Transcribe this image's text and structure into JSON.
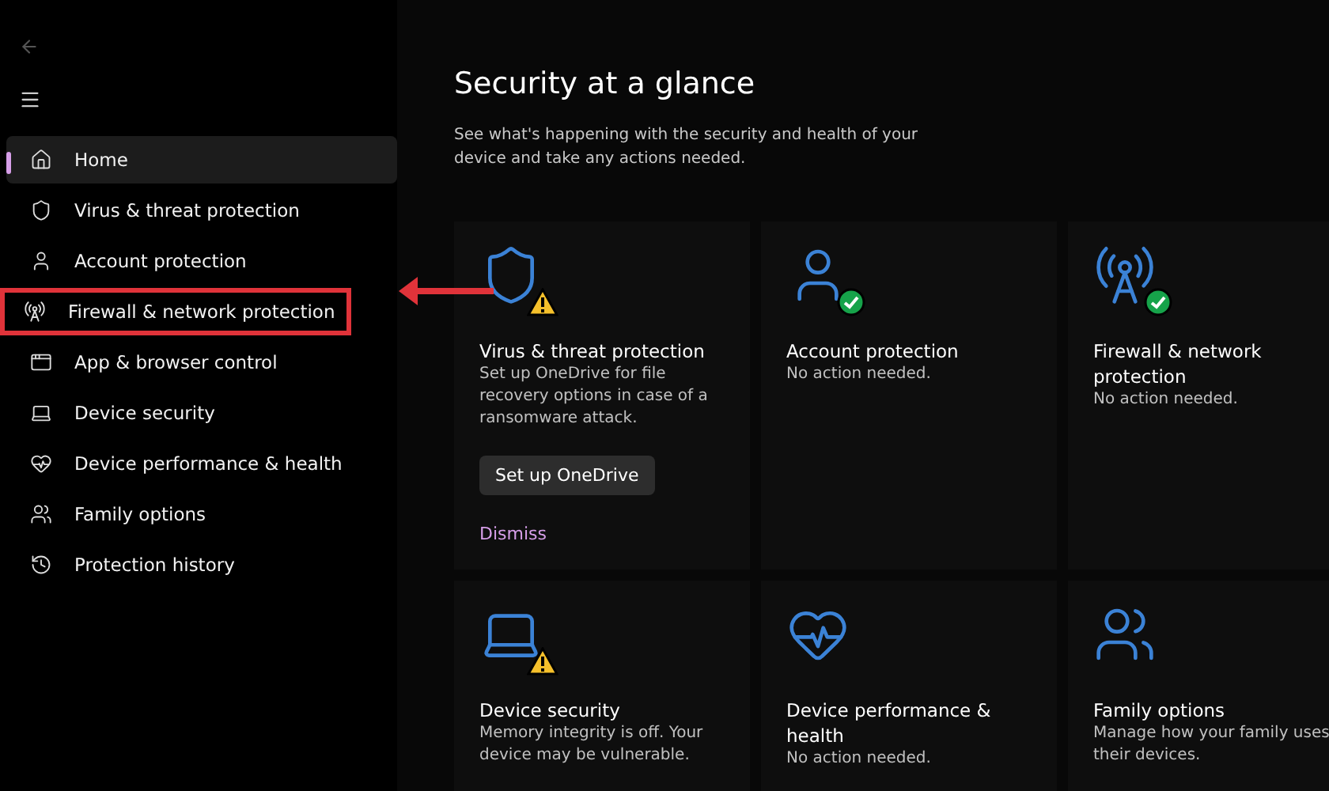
{
  "sidebar": {
    "items": [
      {
        "label": "Home",
        "selected": true,
        "highlighted": false
      },
      {
        "label": "Virus & threat protection",
        "selected": false,
        "highlighted": false
      },
      {
        "label": "Account protection",
        "selected": false,
        "highlighted": false
      },
      {
        "label": "Firewall & network protection",
        "selected": false,
        "highlighted": true
      },
      {
        "label": "App & browser control",
        "selected": false,
        "highlighted": false
      },
      {
        "label": "Device security",
        "selected": false,
        "highlighted": false
      },
      {
        "label": "Device performance & health",
        "selected": false,
        "highlighted": false
      },
      {
        "label": "Family options",
        "selected": false,
        "highlighted": false
      },
      {
        "label": "Protection history",
        "selected": false,
        "highlighted": false
      }
    ]
  },
  "main": {
    "title": "Security at a glance",
    "subtitle": "See what's happening with the security and health of your device and take any actions needed.",
    "cards": [
      {
        "kind": "warning",
        "title": "Virus & threat protection",
        "description": "Set up OneDrive for file recovery options in case of a ransomware attack.",
        "button": "Set up OneDrive",
        "link": "Dismiss"
      },
      {
        "kind": "ok",
        "title": "Account protection",
        "description": "No action needed."
      },
      {
        "kind": "ok",
        "title": "Firewall & network protection",
        "description": "No action needed."
      },
      {
        "kind": "warning",
        "title": "Device security",
        "description": "Memory integrity is off. Your device may be vulnerable."
      },
      {
        "kind": "plain",
        "title": "Device performance & health",
        "description": "No action needed."
      },
      {
        "kind": "plain",
        "title": "Family options",
        "description": "Manage how your family uses their devices."
      }
    ]
  }
}
